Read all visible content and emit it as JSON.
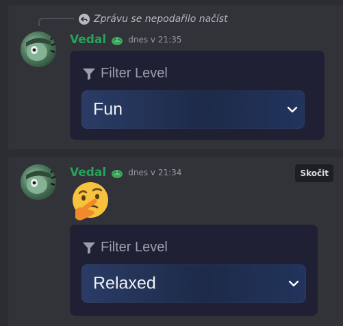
{
  "messages": [
    {
      "reply_preview": "Zprávu se nepodařilo načíst",
      "username": "Vedal",
      "timestamp": "dnes v 21:35",
      "embed": {
        "title": "Filter Level",
        "select_value": "Fun"
      }
    },
    {
      "username": "Vedal",
      "timestamp": "dnes v 21:34",
      "jump_label": "Skočit",
      "emoji": "thinking-face",
      "embed": {
        "title": "Filter Level",
        "select_value": "Relaxed"
      }
    }
  ],
  "icons": {
    "reply": "reply-arrow-icon",
    "badge": "turtle-badge-icon",
    "filter": "funnel-icon",
    "chevron": "chevron-down-icon"
  },
  "colors": {
    "username": "#23a55a",
    "background": "#2b2d31",
    "message_background": "#313338",
    "embed_background": "#1f2034",
    "select_background": "#243558"
  }
}
